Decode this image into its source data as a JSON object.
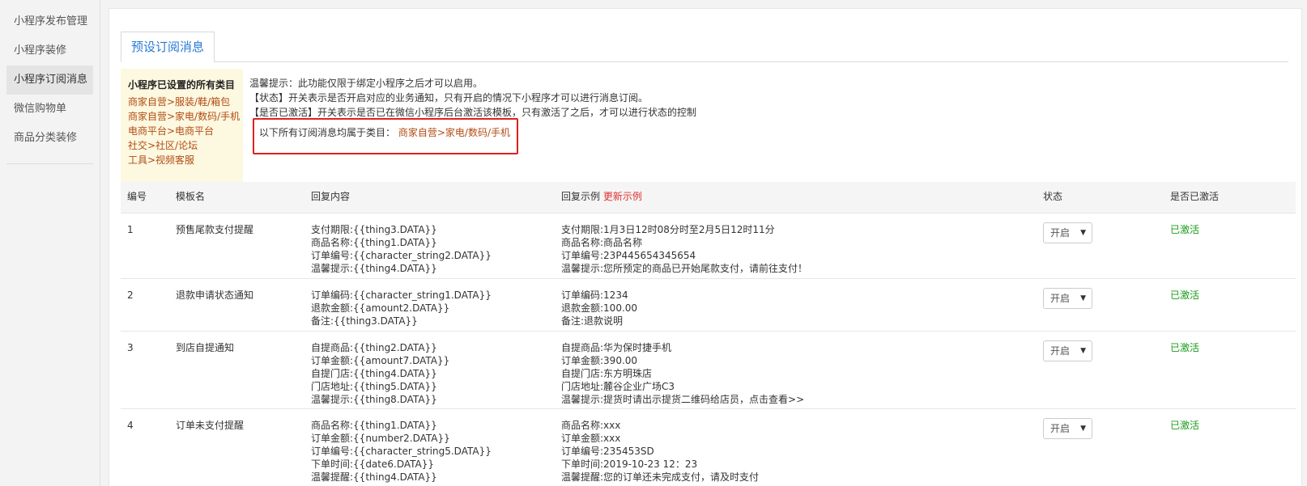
{
  "sidebar": {
    "items": [
      {
        "label": "小程序发布管理"
      },
      {
        "label": "小程序装修"
      },
      {
        "label": "小程序订阅消息"
      },
      {
        "label": "微信购物单"
      },
      {
        "label": "商品分类装修"
      }
    ],
    "active_index": 2
  },
  "tab": {
    "label": "预设订阅消息"
  },
  "categories": {
    "title": "小程序已设置的所有类目",
    "items": [
      "商家自营>服装/鞋/箱包",
      "商家自营>家电/数码/手机",
      "电商平台>电商平台",
      "社交>社区/论坛",
      "工具>视频客服"
    ]
  },
  "tips": {
    "line1": "温馨提示：此功能仅限于绑定小程序之后才可以启用。",
    "line2": "【状态】开关表示是否开启对应的业务通知，只有开启的情况下小程序才可以进行消息订阅。",
    "line3": "【是否已激活】开关表示是否已在微信小程序后台激活该模板，只有激活了之后，才可以进行状态的控制",
    "category_prefix": "以下所有订阅消息均属于类目：",
    "category_value": "商家自营>家电/数码/手机"
  },
  "table": {
    "headers": {
      "no": "编号",
      "name": "模板名",
      "content": "回复内容",
      "example": "回复示例",
      "refresh": "更新示例",
      "state": "状态",
      "active": "是否已激活"
    },
    "rows": [
      {
        "no": "1",
        "name": "预售尾款支付提醒",
        "content": [
          "支付期限:{{thing3.DATA}}",
          "商品名称:{{thing1.DATA}}",
          "订单编号:{{character_string2.DATA}}",
          "温馨提示:{{thing4.DATA}}"
        ],
        "example": [
          "支付期限:1月3日12时08分时至2月5日12时11分",
          "商品名称:商品名称",
          "订单编号:23P445654345654",
          "温馨提示:您所预定的商品已开始尾款支付，请前往支付！"
        ],
        "state": "开启",
        "active": "已激活"
      },
      {
        "no": "2",
        "name": "退款申请状态通知",
        "content": [
          "订单编码:{{character_string1.DATA}}",
          "退款金额:{{amount2.DATA}}",
          "备注:{{thing3.DATA}}"
        ],
        "example": [
          "订单编码:1234",
          "退款金额:100.00",
          "备注:退款说明"
        ],
        "state": "开启",
        "active": "已激活"
      },
      {
        "no": "3",
        "name": "到店自提通知",
        "content": [
          "自提商品:{{thing2.DATA}}",
          "订单金额:{{amount7.DATA}}",
          "自提门店:{{thing4.DATA}}",
          "门店地址:{{thing5.DATA}}",
          "温馨提示:{{thing8.DATA}}"
        ],
        "example": [
          "自提商品:华为保时捷手机",
          "订单金额:390.00",
          "自提门店:东方明珠店",
          "门店地址:麓谷企业广场C3",
          "温馨提示:提货时请出示提货二维码给店员，点击查看>>"
        ],
        "state": "开启",
        "active": "已激活"
      },
      {
        "no": "4",
        "name": "订单未支付提醒",
        "content": [
          "商品名称:{{thing1.DATA}}",
          "订单金额:{{number2.DATA}}",
          "订单编号:{{character_string5.DATA}}",
          "下单时间:{{date6.DATA}}",
          "温馨提醒:{{thing4.DATA}}"
        ],
        "example": [
          "商品名称:xxx",
          "订单金额:xxx",
          "订单编号:235453SD",
          "下单时间:2019-10-23  12：23",
          "温馨提醒:您的订单还未完成支付，请及时支付"
        ],
        "state": "开启",
        "active": "已激活"
      }
    ]
  }
}
